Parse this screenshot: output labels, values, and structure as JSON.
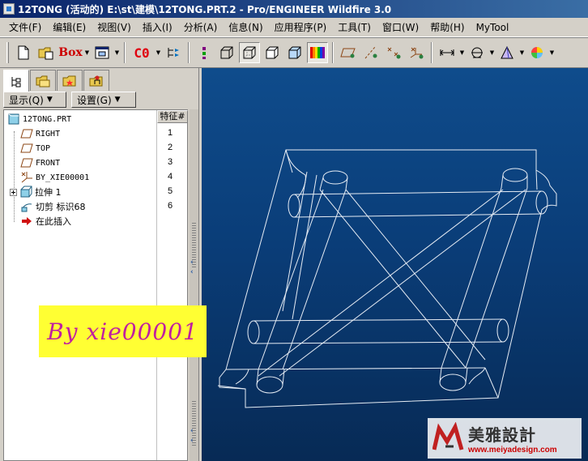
{
  "window": {
    "title": "12TONG (活动的) E:\\st\\建模\\12TONG.PRT.2 - Pro/ENGINEER Wildfire 3.0"
  },
  "menu": [
    "文件(F)",
    "编辑(E)",
    "视图(V)",
    "插入(I)",
    "分析(A)",
    "信息(N)",
    "应用程序(P)",
    "工具(T)",
    "窗口(W)",
    "帮助(H)",
    "MyTool"
  ],
  "toolbar": {
    "box_label": "Box",
    "co_label": "C0"
  },
  "panel": {
    "show_button": "显示(Q)",
    "settings_button": "设置(G)",
    "feature_col_header": "特征#"
  },
  "tree": {
    "root": "12TONG.PRT",
    "items": [
      {
        "label": "RIGHT",
        "num": "1"
      },
      {
        "label": "TOP",
        "num": "2"
      },
      {
        "label": "FRONT",
        "num": "3"
      },
      {
        "label": "BY_XIE00001",
        "num": "4"
      },
      {
        "label": "拉伸 1",
        "num": "5"
      },
      {
        "label": "切剪 标识68",
        "num": "6"
      },
      {
        "label": "在此插入",
        "num": ""
      }
    ]
  },
  "overlay": {
    "signature": "By xie00001"
  },
  "watermark": {
    "brand": "美雅設計",
    "url": "www.meiyadesign.com"
  },
  "colors": {
    "viewport_top": "#0f4c8c",
    "viewport_bottom": "#072a55",
    "titlebar": "#0a246a",
    "overlay_bg": "#ffff33",
    "signature": "#c020a0"
  }
}
